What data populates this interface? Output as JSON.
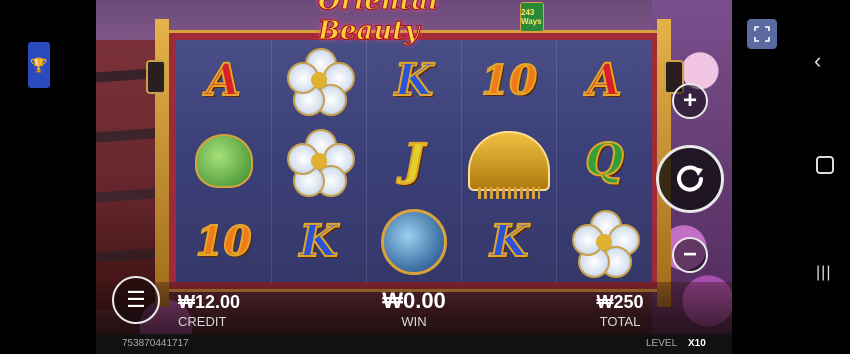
{
  "game": {
    "title": "Oriental Beauty",
    "ways_badge": "243 Ways"
  },
  "reels": [
    [
      "A",
      "K",
      "10",
      "plum-blossom",
      "K"
    ],
    [
      "plum-blossom",
      "J",
      "plum-blossom",
      "10",
      "jade-bag"
    ],
    [
      "A",
      "Q",
      "jeweled-comb",
      "K",
      "mirror"
    ]
  ],
  "hud": {
    "credit_value": "₩12.00",
    "credit_label": "CREDIT",
    "win_value": "₩0.00",
    "win_label": "WIN",
    "total_value": "₩250",
    "total_label": "TOTAL",
    "session_id": "753870441717",
    "level_label": "LEVEL",
    "level_value": "X10"
  },
  "controls": {
    "plus": "+",
    "minus": "−",
    "menu": "☰"
  },
  "icons": {
    "fullscreen": "fullscreen-icon",
    "back": "back-icon",
    "home": "home-icon",
    "recent": "recent-apps-icon",
    "trophy": "trophy-icon",
    "spin": "spin-icon"
  },
  "colors": {
    "frame": "#a02a3a",
    "gold": "#d9a23a",
    "reel_bg": "#3b3f78"
  }
}
